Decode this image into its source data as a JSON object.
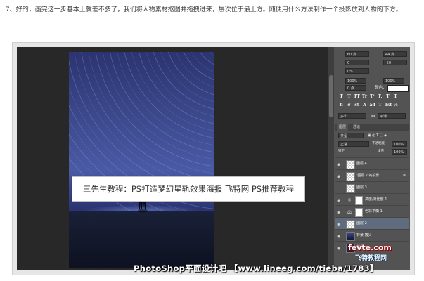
{
  "article": {
    "paragraph": "7、好的，画完这一步基本上就差不多了，我们将人物素材抠图并拖拽进来，层次位于最上方。随便用什么方法制作一个投影放到人物的下方。"
  },
  "caption": "三先生教程：PS打造梦幻星轨效果海报 飞特网 PS推荐教程",
  "character_panel": {
    "font_size": "60 点",
    "leading": "44 点",
    "kerning": "0",
    "tracking": "-50",
    "scale_pct": "0%",
    "vertical_scale": "100%",
    "horizontal_scale": "100%",
    "baseline": "0 点",
    "color_label": "颜色：",
    "text_buttons": [
      "T",
      "T",
      "TT",
      "Tr",
      "T¹",
      "T,",
      "T",
      "T"
    ],
    "ligature_buttons": [
      "fi",
      "σ",
      "st",
      "A",
      "ad",
      "T",
      "1st",
      "½"
    ],
    "language": "美国英语",
    "antialias": "平滑",
    "lang_left": "多个"
  },
  "layers_panel": {
    "tabs": [
      "图层",
      "通道"
    ],
    "filter_label": "类型",
    "blend_mode": "正常",
    "opacity_label": "不透明度",
    "opacity": "100%",
    "lock_label": "锁定",
    "fill_label": "填充",
    "fill": "100%",
    "layers": [
      {
        "name": "图层 4",
        "kind": "pixel",
        "selected": false
      },
      {
        "name": "'图层 7'的投影",
        "kind": "pixel",
        "selected": false
      },
      {
        "name": "图层 3",
        "kind": "pixel",
        "selected": false
      },
      {
        "name": "高度/对比度 1",
        "kind": "adjust",
        "selected": false
      },
      {
        "name": "色彩平衡 1",
        "kind": "adjust",
        "selected": false
      },
      {
        "name": "图层 2",
        "kind": "pixel",
        "selected": true
      },
      {
        "name": "背景 拷贝",
        "kind": "photo",
        "selected": false
      },
      {
        "name": "背景",
        "kind": "photo",
        "selected": false
      }
    ]
  },
  "watermarks": {
    "logo_top": "fevte.com",
    "logo_bottom": "飞特教程网",
    "footer": "PhotoShop平面设计吧 【www.lineeg.com/tieba/1783】"
  },
  "colors": {
    "ps_bg": "#2f2f2f",
    "panel_bg": "#535353",
    "sky_top": "#2b3470",
    "sky_mid": "#4a5aa5",
    "selected_layer": "#5f6c7d"
  }
}
